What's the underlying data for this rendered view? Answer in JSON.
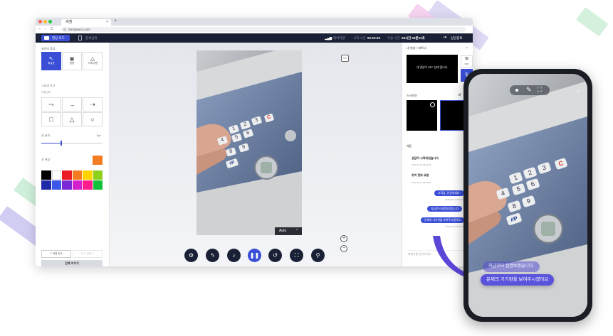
{
  "browser": {
    "tab_title": "세엠",
    "tab_close": "×",
    "new_tab": "+",
    "url": "remotevco.com",
    "nav": [
      "‹",
      "›",
      "C",
      "⊙"
    ]
  },
  "header": {
    "video_mode": "영상 모드",
    "doc_mode": "문서공유",
    "stat_label": "데이터량",
    "time_label": "시작 시간",
    "time_value": "02:15:23",
    "remain_label": "이용 시간",
    "remain_value": "00시간 04분12초",
    "end_label": "상담종료"
  },
  "sidebar": {
    "pointer_title": "포인터 종류",
    "modes": [
      "화살표",
      "원형",
      "스케치/펜"
    ],
    "draw_title": "그리기 도구",
    "shape_title": "도형선택",
    "line_title": "선 굵기",
    "line_value": "5pt",
    "color_title": "선 색상",
    "undo": "작업 취소",
    "redo": "다시 실행",
    "clear_all": "전체 지우기"
  },
  "stage": {
    "auto_label": "Auto",
    "controls": [
      "settings",
      "flashlight",
      "mic",
      "pause",
      "rotate",
      "capture",
      "location"
    ]
  },
  "right_panel": {
    "my_video_title": "내 영상 / 파트너",
    "video_off_msg": "내 영상이 OFF 상태 입니다.",
    "side_btn": "OFF",
    "share_title": "스크린샷",
    "chat_title": "채팅",
    "chat_start": "상담이 시작되었습니다.",
    "chat_start_time": "2020-02-17 PM 3:06",
    "location_req": "위치 정보 요청",
    "location_time": "2020-02-17 PM 3:06",
    "msg1": "고객님, 안녕하세요~",
    "msg1_time": "2020-02-17 PM 3:07",
    "msg2": "지금부터 설명보겠습니다",
    "msg3": "문제의 기기판을 보여주시겠어요",
    "msg3_time": "2020-02-17 PM 3:07",
    "input_placeholder": "메세지를 입력하세요"
  },
  "phone": {
    "bubble_top": "지금부터 설명보겠습니다.",
    "bubble_main": "문제의 기기판을 보여주시겠어요"
  },
  "keypad_labels": [
    "1",
    "2",
    "3",
    "4",
    "5",
    "6",
    "7",
    "8",
    "9",
    "C",
    "#P"
  ],
  "colors": {
    "accent": "#3a4fd6",
    "header_bg": "#1a2137",
    "orange": "#f37b21",
    "ribbon_purple": "#b9b2ea",
    "ribbon_green": "#b6e7c6",
    "ribbon_pink": "#f2c5ea"
  }
}
